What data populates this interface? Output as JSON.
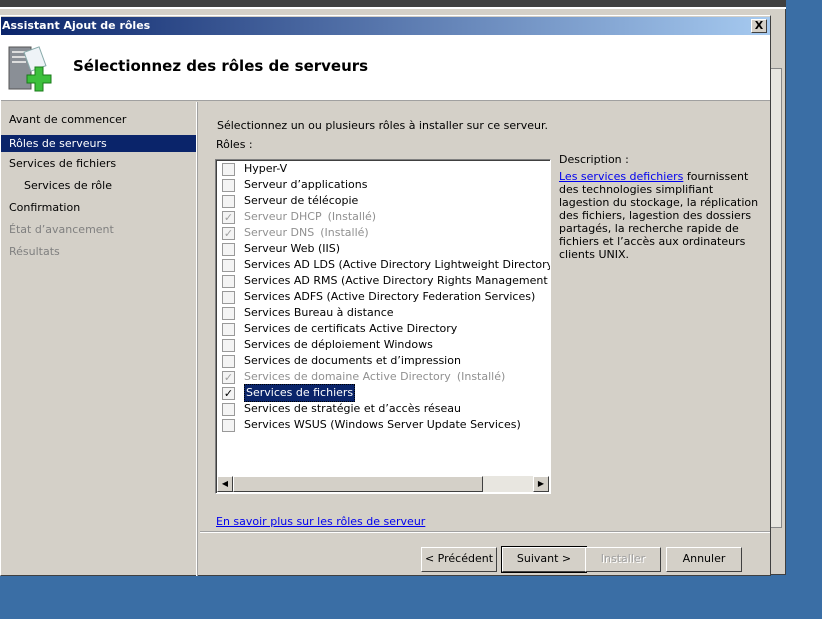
{
  "window": {
    "title": "Assistant Ajout de rôles",
    "close": "X"
  },
  "header": {
    "title": "Sélectionnez des rôles de serveurs",
    "icon": "server-add-icon"
  },
  "sidebar": {
    "items": [
      {
        "label": "Avant de commencer",
        "state": "normal"
      },
      {
        "label": "Rôles de serveurs",
        "state": "selected"
      },
      {
        "label": "Services de fichiers",
        "state": "normal"
      },
      {
        "label": "Services de rôle",
        "state": "sub"
      },
      {
        "label": "Confirmation",
        "state": "normal"
      },
      {
        "label": "État d’avancement",
        "state": "disabled"
      },
      {
        "label": "Résultats",
        "state": "disabled"
      }
    ]
  },
  "main": {
    "instruction": "Sélectionnez un ou plusieurs rôles à installer sur ce serveur.",
    "roles_label": "Rôles :",
    "roles": [
      {
        "label": "Hyper-V",
        "checked": false,
        "installed": ""
      },
      {
        "label": "Serveur d’applications",
        "checked": false,
        "installed": ""
      },
      {
        "label": "Serveur de télécopie",
        "checked": false,
        "installed": ""
      },
      {
        "label": "Serveur DHCP",
        "checked": true,
        "installed": "(Installé)"
      },
      {
        "label": "Serveur DNS",
        "checked": true,
        "installed": "(Installé)"
      },
      {
        "label": "Serveur Web (IIS)",
        "checked": false,
        "installed": ""
      },
      {
        "label": "Services AD LDS (Active Directory Lightweight Directory Services)",
        "checked": false,
        "installed": ""
      },
      {
        "label": "Services AD RMS (Active Directory Rights Management Services)",
        "checked": false,
        "installed": ""
      },
      {
        "label": "Services ADFS (Active Directory Federation Services)",
        "checked": false,
        "installed": ""
      },
      {
        "label": "Services Bureau à distance",
        "checked": false,
        "installed": ""
      },
      {
        "label": "Services de certificats Active Directory",
        "checked": false,
        "installed": ""
      },
      {
        "label": "Services de déploiement Windows",
        "checked": false,
        "installed": ""
      },
      {
        "label": "Services de documents et d’impression",
        "checked": false,
        "installed": ""
      },
      {
        "label": "Services de domaine Active Directory",
        "checked": true,
        "installed": "(Installé)"
      },
      {
        "label": "Services de fichiers",
        "checked": true,
        "installed": "",
        "selected": true
      },
      {
        "label": "Services de stratégie et d’accès réseau",
        "checked": false,
        "installed": ""
      },
      {
        "label": "Services WSUS (Windows Server Update Services)",
        "checked": false,
        "installed": ""
      }
    ],
    "description_label": "Description :",
    "description_link": "Les services defichiers",
    "description_text": " fournissent des technologies simplifiant lagestion du stockage, la réplication des fichiers, lagestion des dossiers partagés, la recherche rapide de fichiers et l’accès aux ordinateurs clients UNIX.",
    "more_link": "En savoir plus sur les rôles de serveur"
  },
  "buttons": {
    "previous": "< Précédent",
    "next": "Suivant >",
    "install": "Installer",
    "cancel": "Annuler"
  },
  "colors": {
    "titlebar_start": "#0a246a",
    "titlebar_end": "#a6caf0",
    "selection": "#0a246a",
    "desktop": "#3a6ea5",
    "link": "#0000ee"
  }
}
